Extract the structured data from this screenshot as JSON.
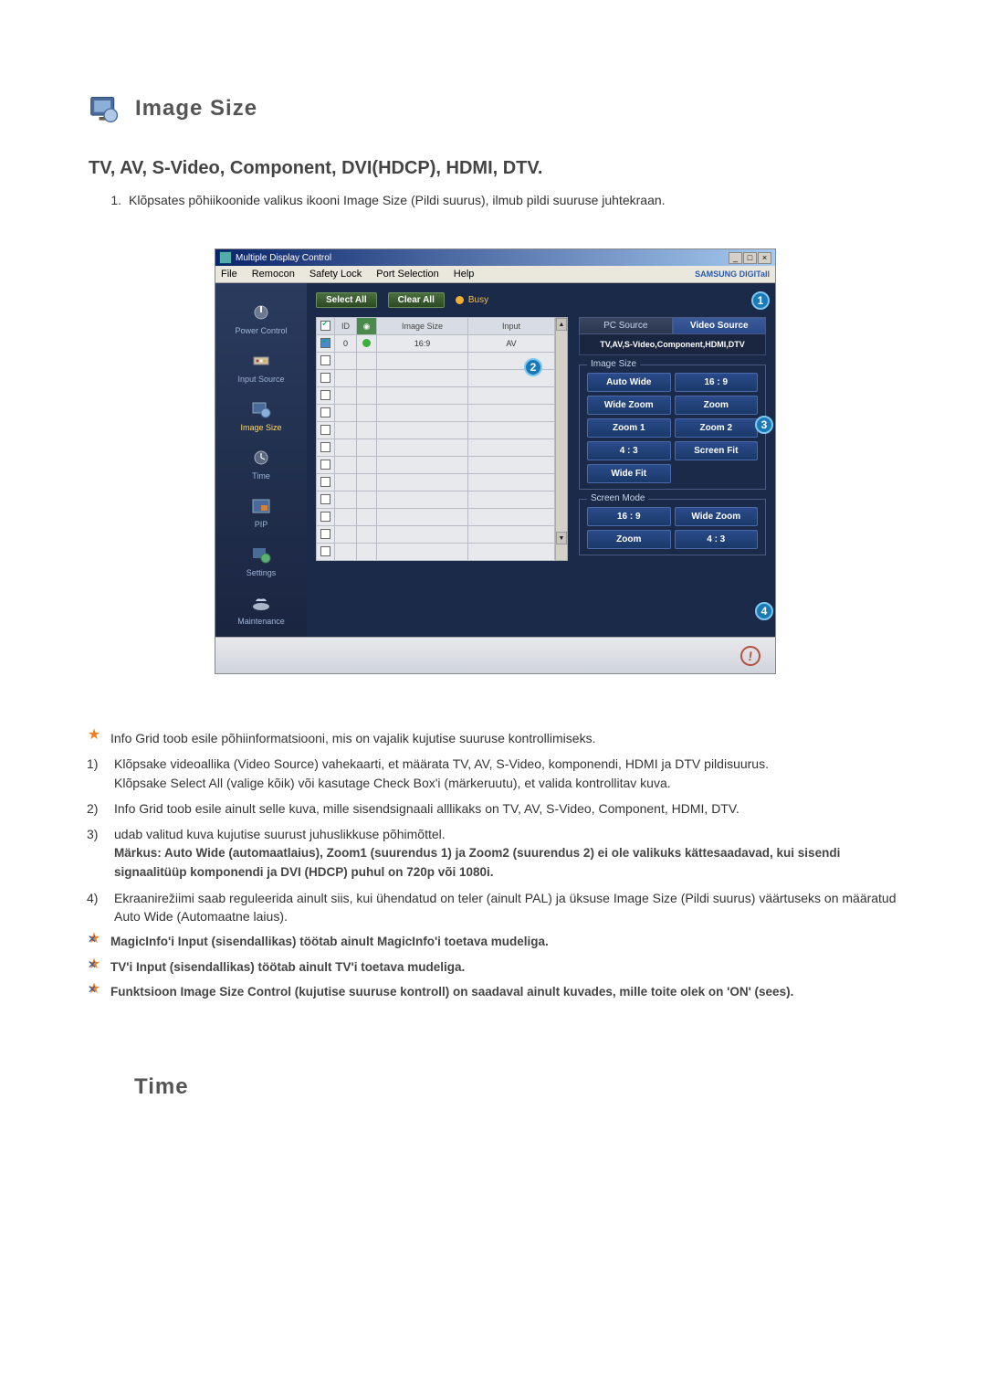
{
  "section": {
    "title": "Image Size",
    "subtitle": "TV, AV, S-Video, Component, DVI(HDCP), HDMI, DTV."
  },
  "intro": {
    "num": "1.",
    "text": "Klõpsates põhiikoonide valikus ikooni Image Size (Pildi suurus), ilmub pildi suuruse juhtekraan."
  },
  "app": {
    "title": "Multiple Display Control",
    "menu": {
      "file": "File",
      "remocon": "Remocon",
      "safety": "Safety Lock",
      "port": "Port Selection",
      "help": "Help"
    },
    "logo": "SAMSUNG DIGITall",
    "toolbar": {
      "selectAll": "Select All",
      "clearAll": "Clear All",
      "busy": "Busy"
    },
    "sidebar": {
      "power": "Power Control",
      "input": "Input Source",
      "imagesize": "Image Size",
      "time": "Time",
      "pip": "PIP",
      "settings": "Settings",
      "maintenance": "Maintenance"
    },
    "gridHeaders": {
      "chk": "",
      "id": "ID",
      "stat": "",
      "imgsize": "Image Size",
      "input": "Input"
    },
    "gridRow": {
      "id": "0",
      "imgsize": "16:9",
      "input": "AV"
    },
    "tabs": {
      "pc": "PC Source",
      "video": "Video Source"
    },
    "sourceLabel": "TV,AV,S-Video,Component,HDMI,DTV",
    "imageSizeGroup": {
      "label": "Image Size",
      "buttons": {
        "autowide": "Auto Wide",
        "ratio16_9": "16 : 9",
        "widezoom": "Wide Zoom",
        "zoom": "Zoom",
        "zoom1": "Zoom 1",
        "zoom2": "Zoom 2",
        "ratio4_3": "4 : 3",
        "screenfit": "Screen Fit",
        "widefit": "Wide Fit"
      }
    },
    "screenModeGroup": {
      "label": "Screen Mode",
      "buttons": {
        "ratio16_9": "16 : 9",
        "widezoom": "Wide Zoom",
        "zoom": "Zoom",
        "ratio4_3": "4 : 3"
      }
    },
    "badges": {
      "b1": "1",
      "b2": "2",
      "b3": "3",
      "b4": "4"
    }
  },
  "notes": {
    "star1": "Info Grid toob esile põhiinformatsiooni, mis on vajalik kujutise suuruse kontrollimiseks.",
    "n1a": "Klõpsake videoallika (Video Source) vahekaarti, et määrata TV, AV, S-Video, komponendi, HDMI ja DTV pildisuurus.",
    "n1b": "Klõpsake Select All (valige kõik) või kasutage Check Box'i (märkeruutu), et valida kontrollitav kuva.",
    "n2": "Info Grid toob esile ainult selle kuva, mille sisendsignaali alllikaks on TV, AV, S-Video, Component, HDMI, DTV.",
    "n3a": "udab valitud kuva kujutise suurust juhuslikkuse põhimõttel.",
    "n3b": "Märkus: Auto Wide (automaatlaius), Zoom1 (suurendus 1) ja Zoom2 (suurendus 2) ei ole valikuks kättesaadavad, kui sisendi signaalitüüp komponendi ja DVI (HDCP) puhul on 720p või 1080i.",
    "n4": "Ekraanirežiimi saab reguleerida ainult siis, kui ühendatud on teler (ainult PAL) ja üksuse Image Size (Pildi suurus) väärtuseks on määratud Auto Wide (Automaatne laius).",
    "starX1": "MagicInfo'i Input (sisendallikas) töötab ainult MagicInfo'i toetava mudeliga.",
    "starX2": "TV'i Input (sisendallikas) töötab ainult TV'i toetava mudeliga.",
    "starX3": "Funktsioon Image Size Control (kujutise suuruse kontroll) on saadaval ainult kuvades, mille toite olek on 'ON' (sees)."
  },
  "timeSection": {
    "title": "Time"
  }
}
